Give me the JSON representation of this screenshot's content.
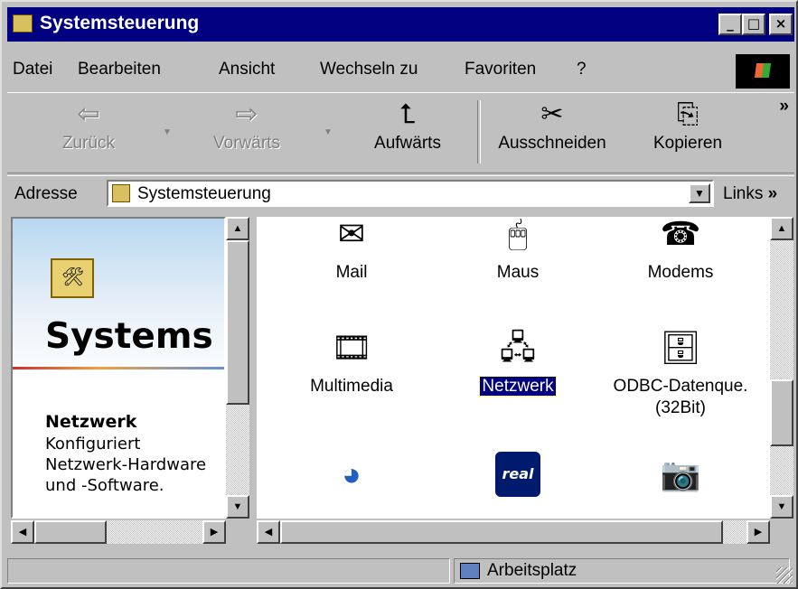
{
  "window": {
    "title": "Systemsteuerung",
    "controls": {
      "minimize": "_",
      "maximize": "□",
      "close": "×"
    }
  },
  "menu": [
    {
      "label": "Datei"
    },
    {
      "label": "Bearbeiten"
    },
    {
      "label": "Ansicht"
    },
    {
      "label": "Wechseln zu"
    },
    {
      "label": "Favoriten"
    },
    {
      "label": "?"
    }
  ],
  "toolbar": {
    "back": {
      "label": "Zurück",
      "icon": "back-arrow-icon",
      "glyph": "⇦",
      "enabled": false
    },
    "forward": {
      "label": "Vorwärts",
      "icon": "forward-arrow-icon",
      "glyph": "⇨",
      "enabled": false
    },
    "up": {
      "label": "Aufwärts",
      "icon": "folder-up-icon",
      "glyph": "⮤"
    },
    "cut": {
      "label": "Ausschneiden",
      "icon": "scissors-icon",
      "glyph": "✂"
    },
    "copy": {
      "label": "Kopieren",
      "icon": "copy-icon",
      "glyph": "⎘"
    },
    "more": "»"
  },
  "address": {
    "label": "Adresse",
    "value": "Systemsteuerung",
    "links_label": "Links",
    "links_more": "»"
  },
  "info_panel": {
    "heading": "Systems",
    "item_name": "Netzwerk",
    "item_description": "Konfiguriert Netzwerk-Hardware und -Software."
  },
  "icons": [
    {
      "label": "Mail",
      "icon": "mail-icon",
      "glyph": "✉"
    },
    {
      "label": "Maus",
      "icon": "mouse-icon",
      "glyph": "🖱"
    },
    {
      "label": "Modems",
      "icon": "modem-icon",
      "glyph": "☎"
    },
    {
      "label": "Multimedia",
      "icon": "multimedia-icon",
      "glyph": "🎞"
    },
    {
      "label": "Netzwerk",
      "icon": "network-icon",
      "glyph": "🖧",
      "selected": true
    },
    {
      "label": "ODBC-Datenque.",
      "label2": "(32Bit)",
      "icon": "odbc-icon",
      "glyph": "🗄"
    },
    {
      "label": "",
      "icon": "quicktime-icon",
      "glyph": "◕"
    },
    {
      "label": "",
      "icon": "real-player-icon",
      "glyph": "real"
    },
    {
      "label": "",
      "icon": "scanner-camera-icon",
      "glyph": "📷"
    }
  ],
  "status": {
    "zone": "Arbeitsplatz"
  },
  "colors": {
    "titlebar": "#000080",
    "face": "#c0c0c0",
    "selection": "#000080"
  }
}
